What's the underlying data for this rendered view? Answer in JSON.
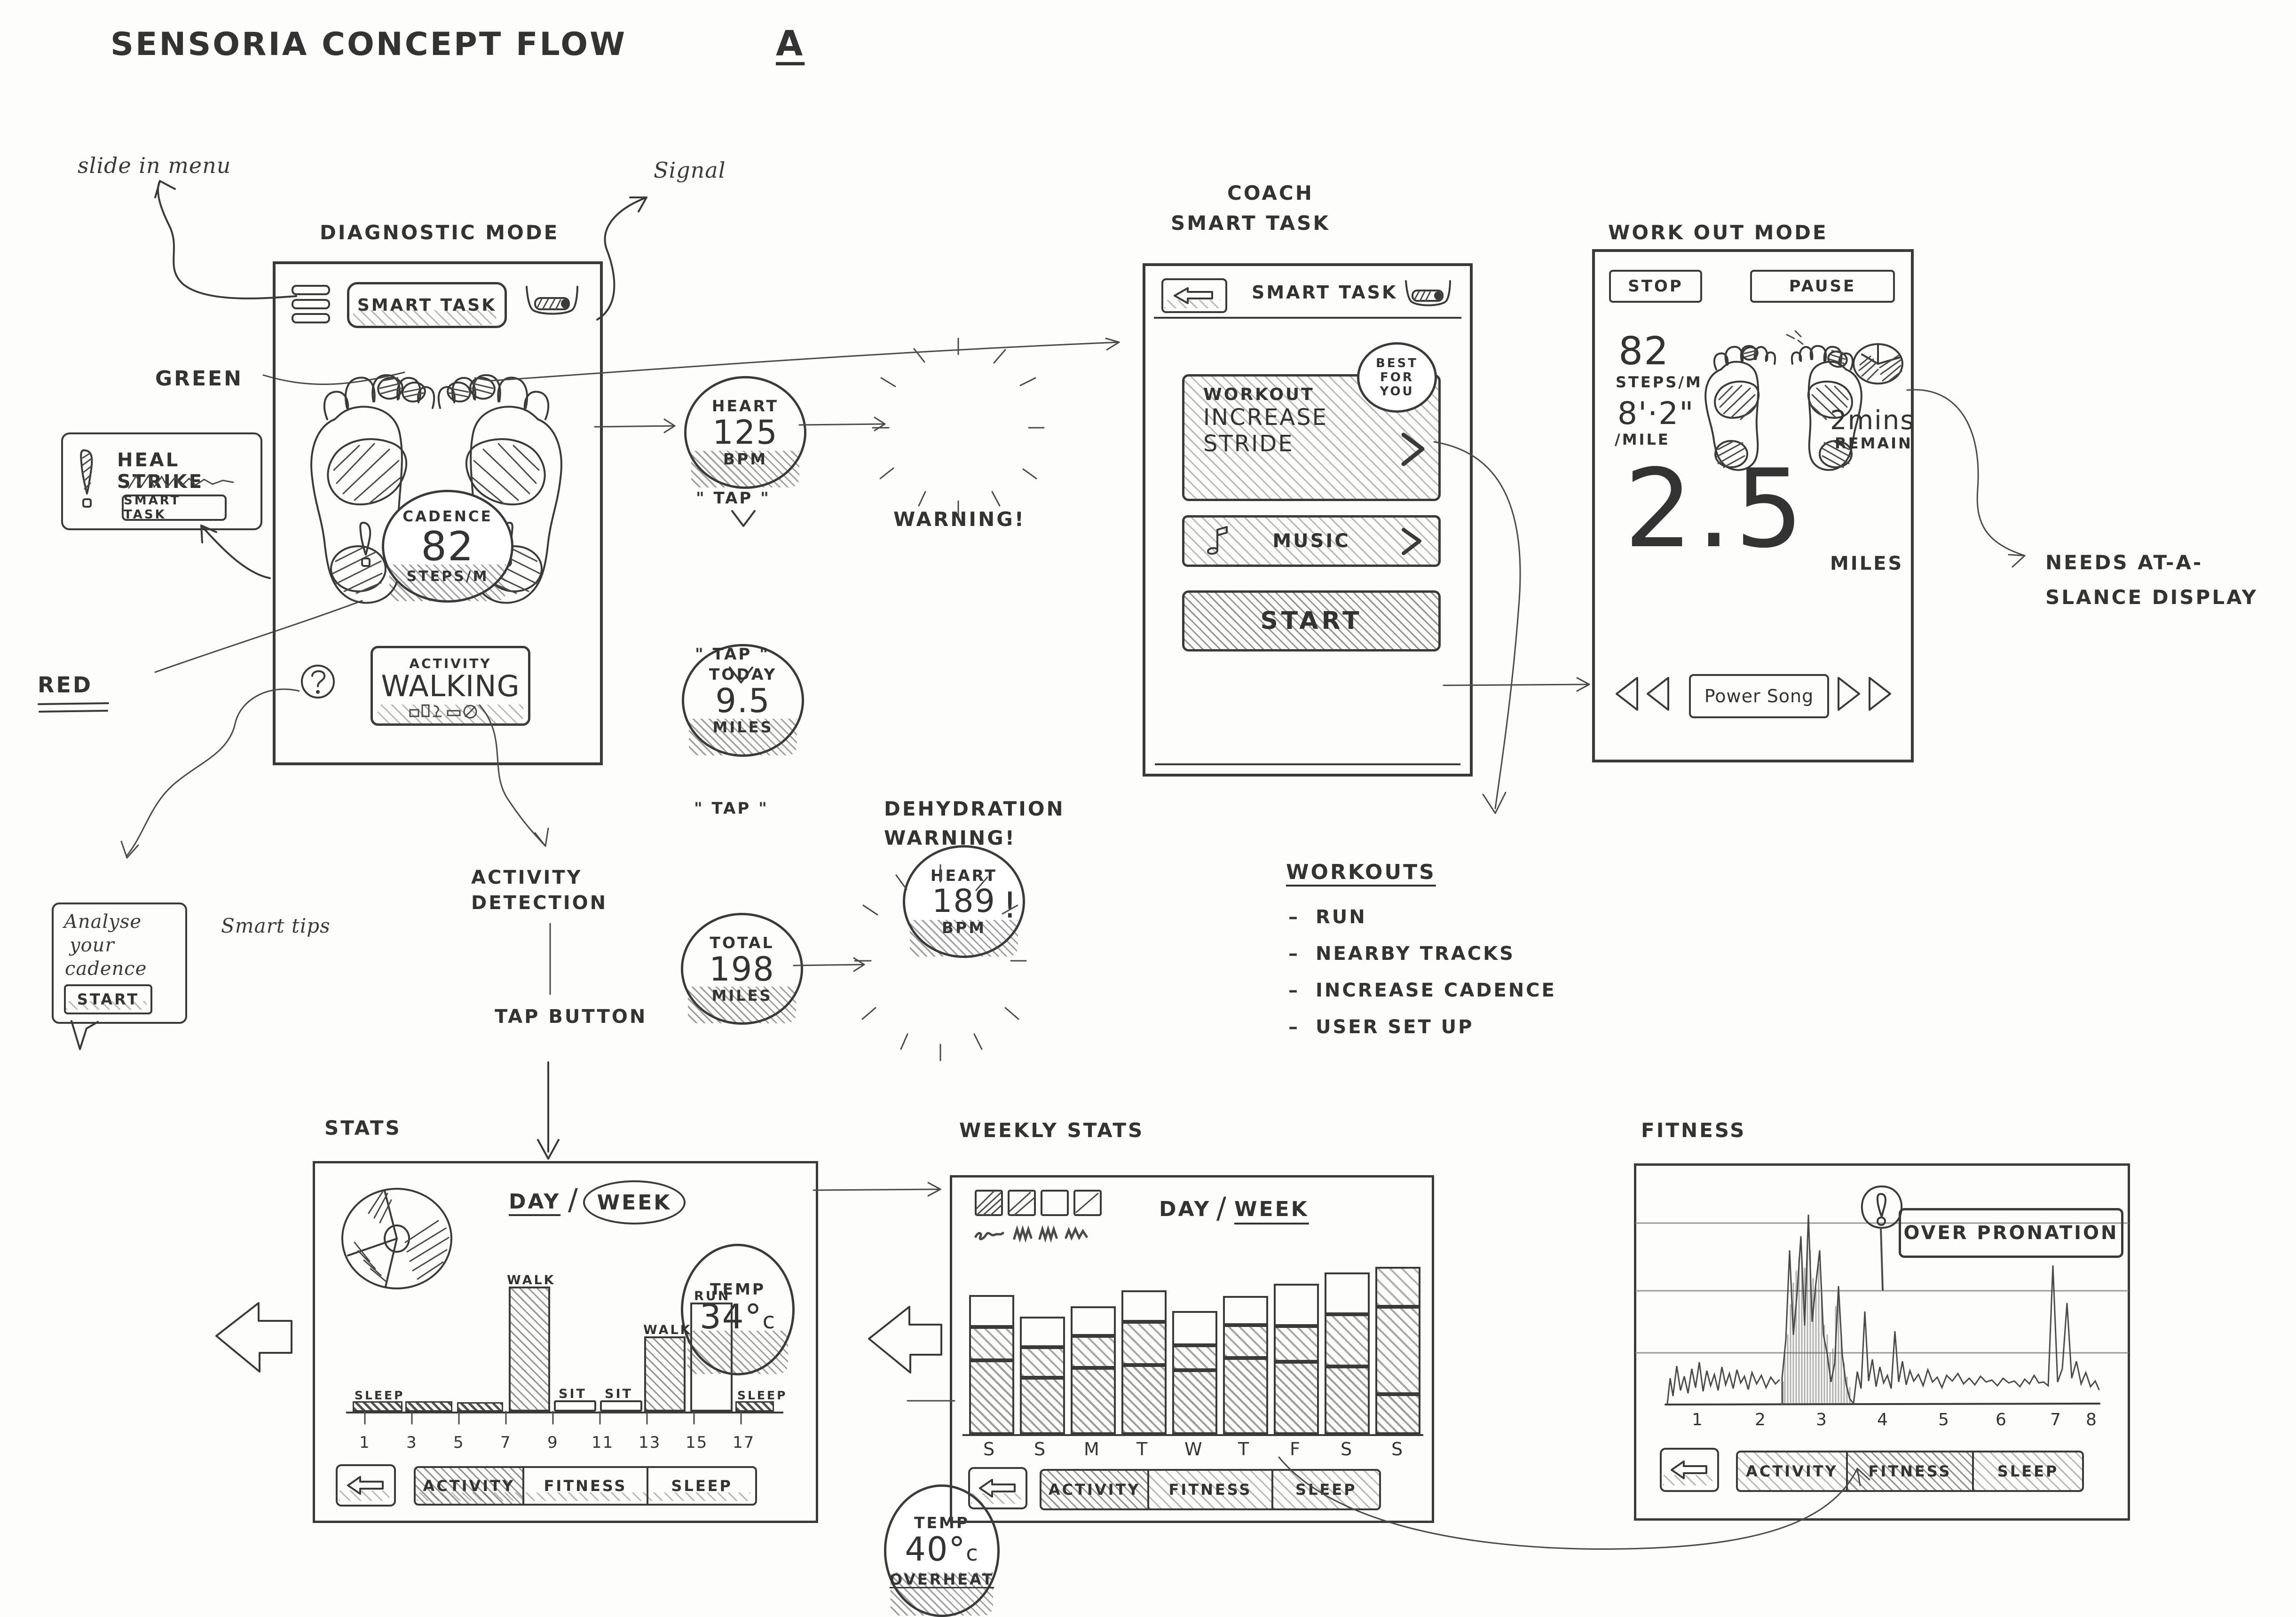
{
  "page": {
    "title": "SENSORIA   CONCEPT  FLOW",
    "title_suffix": "A"
  },
  "annotations": {
    "slide_in_menu": "slide in menu",
    "signal": "Signal",
    "green": "GREEN",
    "red": "RED",
    "smart_tips": "Smart tips",
    "activity_detection": "ACTIVITY DETECTION",
    "tap_button": "TAP BUTTON",
    "warning": "WARNING!",
    "dehydration_warning": "DEHYDRATION WARNING!",
    "needs_display": "NEEDS AT-A-SLANCE DISPLAY",
    "tap1": "\" TAP \"",
    "tap2": "\" TAP \"",
    "tap3": "\" TAP \""
  },
  "headers": {
    "diagnostic": "DIAGNOSTIC MODE",
    "coach": "COACH",
    "coach_sub": "SMART TASK",
    "workout": "WORK OUT MODE",
    "stats": "STATS",
    "weekly_stats": "WEEKLY STATS",
    "fitness": "FITNESS"
  },
  "heal_strike_popup": {
    "title": "HEAL STRIKE",
    "button": "SMART TASK",
    "icon": "exclamation-icon"
  },
  "cadence_popup": {
    "line1": "Analyse",
    "line2": "your",
    "line3": "cadence",
    "button": "START"
  },
  "phone_diagnostic": {
    "menu_icon": "hamburger-menu-icon",
    "title_pill": "SMART TASK",
    "signal_icon": "signal-battery-icon",
    "cadence_label": "CADENCE",
    "cadence_value": "82",
    "cadence_unit": "STEPS/M",
    "help_icon": "question-mark-icon",
    "activity_label": "ACTIVITY",
    "activity_value": "WALKING",
    "activity_icons": "activity-detection-icons"
  },
  "metric_circles": [
    {
      "label": "HEART",
      "value": "125",
      "unit": "BPM",
      "name": "heart-rate-circle"
    },
    {
      "label": "TODAY",
      "value": "9.5",
      "unit": "MILES",
      "name": "today-distance-circle"
    },
    {
      "label": "TOTAL",
      "value": "198",
      "unit": "MILES",
      "name": "total-distance-circle"
    },
    {
      "label": "TEMP",
      "value": "34°",
      "unit": "c",
      "name": "temperature-circle"
    }
  ],
  "alert_circles": [
    {
      "label": "HEART",
      "value": "189",
      "unit": "BPM",
      "mark": "!",
      "name": "heart-rate-alert-circle"
    },
    {
      "label": "TEMP",
      "value": "40°",
      "unit": "c",
      "mark": "OVERHEAT",
      "name": "overheat-alert-circle"
    }
  ],
  "phone_coach": {
    "back_icon": "back-arrow-icon",
    "title": "SMART TASK",
    "signal_icon": "signal-battery-icon",
    "card_kicker": "WORKOUT",
    "card_line1": "INCREASE",
    "card_line2": "STRIDE",
    "badge_l1": "BEST",
    "badge_l2": "FOR",
    "badge_l3": "YOU",
    "chevron_icon": "chevron-right-icon",
    "music_icon": "music-note-icon",
    "music_label": "MUSIC",
    "start_button": "START"
  },
  "phone_workout": {
    "stop_button": "STOP",
    "pause_button": "PAUSE",
    "cadence_value": "82",
    "cadence_unit": "STEPS/M",
    "pace_value": "8'·2\"",
    "pace_unit": "/MILE",
    "time_value": "2mins",
    "time_unit": "REMAIN",
    "distance_value": "2.5",
    "distance_unit": "MILES",
    "prev_icon": "prev-track-icon",
    "next_icon": "next-track-icon",
    "track_label": "Power Song",
    "pie_icon": "pie-chart-icon"
  },
  "workouts_list": {
    "title": "WORKOUTS",
    "items": [
      "RUN",
      "NEARBY TRACKS",
      "INCREASE CADENCE",
      "USER SET UP"
    ]
  },
  "stats_panel": {
    "back_icon": "back-arrow-icon",
    "toggle_day": "DAY",
    "toggle_sep": "/",
    "toggle_week": "WEEK",
    "selected_toggle": "WEEK",
    "tabs": [
      "ACTIVITY",
      "FITNESS",
      "SLEEP"
    ],
    "active_tab": "ACTIVITY",
    "donut_icon": "donut-chart-icon"
  },
  "weekly_panel": {
    "back_icon": "back-arrow-icon",
    "toggle_day": "DAY",
    "toggle_sep": "/",
    "toggle_week": "WEEK",
    "selected_toggle": "WEEK",
    "tabs": [
      "ACTIVITY",
      "FITNESS",
      "SLEEP"
    ],
    "active_tab": "ACTIVITY",
    "legend_swatches": [
      "swatch-dense-hatch",
      "swatch-medium-hatch",
      "swatch-empty",
      "swatch-light-hatch"
    ],
    "legend_scribble": "sleep  walk  run  rest"
  },
  "fitness_panel": {
    "back_icon": "back-arrow-icon",
    "callout_icon": "exclamation-pin-icon",
    "callout_text": "OVER PRONATION",
    "tabs": [
      "ACTIVITY",
      "FITNESS",
      "SLEEP"
    ],
    "active_tab": "FITNESS"
  },
  "chart_data": [
    {
      "type": "bar",
      "title": "STATS",
      "name": "daily-activity-bar-chart",
      "xlabel": "",
      "ylabel": "",
      "x": [
        1,
        2,
        3,
        4,
        5,
        6,
        7,
        8,
        9
      ],
      "tick_labels": [
        "1",
        "3",
        "5",
        "7",
        "9",
        "11",
        "13",
        "15",
        "17"
      ],
      "categories": [
        "SLEEP",
        "SLEEP",
        "SLEEP",
        "WALK",
        "SIT",
        "SIT",
        "WALK",
        "RUN",
        "SLEEP"
      ],
      "values": [
        4,
        4,
        4,
        86,
        5,
        5,
        52,
        75,
        4
      ],
      "ylim": [
        0,
        100
      ],
      "bar_labels": [
        "SLEEP",
        "",
        "",
        "WALK",
        "SIT",
        "SIT",
        "WALK",
        "RUN",
        "SLEEP"
      ],
      "grid": false
    },
    {
      "type": "bar",
      "title": "WEEKLY STATS",
      "name": "weekly-stacked-bar-chart",
      "stacked": true,
      "categories": [
        "S",
        "S",
        "M",
        "T",
        "W",
        "T",
        "F",
        "S",
        "S"
      ],
      "series": [
        {
          "name": "segment-1",
          "values": [
            48,
            36,
            44,
            40,
            40,
            50,
            44,
            38,
            40
          ]
        },
        {
          "name": "segment-2",
          "values": [
            22,
            20,
            22,
            26,
            14,
            22,
            20,
            28,
            30
          ]
        },
        {
          "name": "segment-3",
          "values": [
            12,
            10,
            12,
            16,
            16,
            14,
            18,
            22,
            18
          ]
        }
      ],
      "ylim": [
        0,
        100
      ],
      "grid": false
    },
    {
      "type": "line",
      "title": "FITNESS",
      "name": "fitness-waveform-chart",
      "xlabel": "",
      "ylabel": "",
      "tick_labels": [
        "1",
        "2",
        "3",
        "4",
        "5",
        "6",
        "7",
        "8"
      ],
      "xlim": [
        1,
        8
      ],
      "ylim": [
        0,
        100
      ],
      "grid": true,
      "gridlines_y": [
        25,
        50,
        75,
        100
      ],
      "annotation": "OVER PRONATION",
      "annotation_x": 3.4,
      "highlight_region": [
        2.9,
        4.2
      ],
      "series": [
        {
          "name": "pronation-trace",
          "values": [
            2,
            28,
            12,
            34,
            16,
            22,
            14,
            30,
            18,
            36,
            14,
            30,
            20,
            26,
            16,
            32,
            18,
            26,
            14,
            22,
            62,
            40,
            78,
            30,
            88,
            36,
            72,
            46,
            34,
            26,
            14,
            30,
            18,
            52,
            20,
            34,
            16,
            30,
            22,
            18,
            26,
            14,
            22,
            18,
            26,
            16,
            22,
            12,
            18,
            14,
            20,
            12,
            18,
            10,
            16,
            12,
            20,
            14,
            22,
            12,
            18,
            16,
            68,
            22,
            44,
            16,
            26,
            14,
            20,
            10
          ]
        }
      ]
    }
  ]
}
